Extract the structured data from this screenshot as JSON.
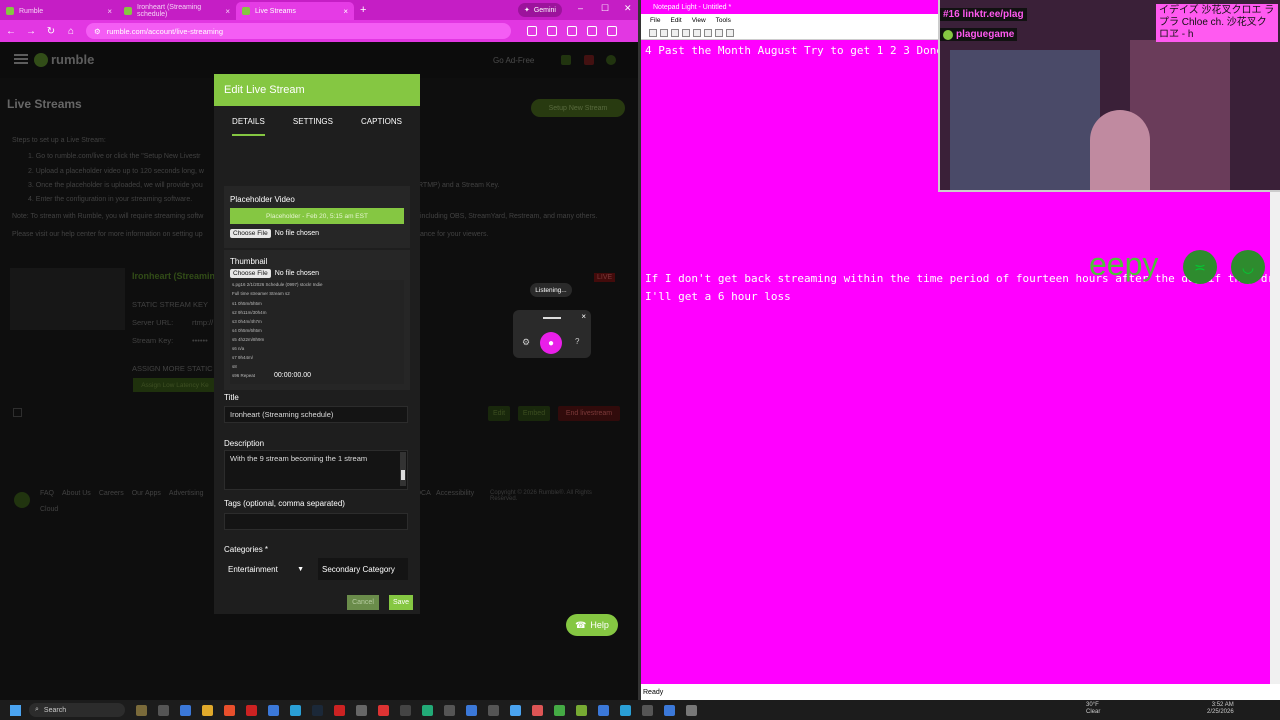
{
  "browser": {
    "tabs": [
      {
        "label": "Rumble",
        "active": false
      },
      {
        "label": "Ironheart (Streaming schedule)",
        "active": false
      },
      {
        "label": "Live Streams",
        "active": true
      }
    ],
    "gemini_label": "Gemini",
    "url": "rumble.com/account/live-streaming"
  },
  "rumble": {
    "logo_text": "rumble",
    "go_ad_free": "Go Ad-Free",
    "page_title": "Live Streams",
    "setup_button": "Setup New Stream",
    "steps_heading": "Steps to set up a Live Stream:",
    "steps": [
      "1. Go to rumble.com/live or click the \"Setup New Livestr",
      "2. Upload a placeholder video up to 120 seconds long, w",
      "3. Once the placeholder is uploaded, we will provide you",
      "4. Enter the configuration in your streaming software."
    ],
    "step3_tail": "RTMP) and a Stream Key.",
    "note": "Note: To stream with Rumble, you will require streaming softw",
    "note_tail": "including OBS, StreamYard, Restream, and many others.",
    "visit": "Please visit our help center for more information on setting up",
    "visit_tail": "ance for your viewers.",
    "stream_name": "Ironheart (Streamin",
    "static_key_label": "STATIC STREAM KEY",
    "server_url_label": "Server URL:",
    "server_url_value": "rtmp://",
    "stream_key_label": "Stream Key:",
    "stream_key_value": "••••••",
    "live_badge": "LIVE",
    "assign_label": "ASSIGN MORE STATIC STR",
    "assign_button": "Assign Low Latency Ke",
    "edit_btn": "Edit",
    "embed_btn": "Embed",
    "end_btn": "End livestream",
    "footer_links": [
      "FAQ",
      "About Us",
      "Careers",
      "Our Apps",
      "Advertising"
    ],
    "footer_cloud": "Cloud",
    "footer_ext": [
      "DCA",
      "Accessibility"
    ],
    "copyright": "Copyright © 2026 Rumble®. All Rights Reserved.",
    "help_button": "Help"
  },
  "modal": {
    "title": "Edit Live Stream",
    "tabs": [
      "DETAILS",
      "SETTINGS",
      "CAPTIONS"
    ],
    "placeholder_label": "Placeholder Video",
    "placeholder_value": "Placeholder - Feb 20, 5:15 am EST",
    "choose_file": "Choose File",
    "no_file": "No file chosen",
    "thumbnail_label": "Thumbnail",
    "thumb_lines": [
      "s.pg16 2/1/2026 Schedule (0997) stock! Indie",
      "Full time streamer Stream s2",
      "s1 0h5m/5h5m",
      "s2 9h11m/30h4m",
      "s3 0h4m/4h7m",
      "s4 0h5m/6h5m",
      "s5 4h22m/8h9m",
      "s6 n/a",
      "s7 9h44m/",
      "s8",
      "s96 Repeat"
    ],
    "thumb_time": "00:00:00.00",
    "title_label": "Title",
    "title_value": "Ironheart (Streaming schedule)",
    "description_label": "Description",
    "description_value": "With the 9 stream becoming the 1 stream",
    "tags_label": "Tags (optional, comma separated)",
    "tags_value": "",
    "categories_label": "Categories *",
    "primary_category": "Entertainment",
    "secondary_category": "Secondary Category",
    "cancel": "Cancel",
    "save": "Save"
  },
  "voice": {
    "listening": "Listening..."
  },
  "notepad": {
    "title": "Notepad Light - Untitled *",
    "menu": [
      "File",
      "Edit",
      "View",
      "Tools"
    ],
    "line1": "4 Past the Month August Try to get 1 2 3 Done",
    "line2": "If I don't get back streaming within the time period of fourteen hours after the day if they dre",
    "line3": "I'll get a 6 hour loss",
    "status": "Ready"
  },
  "overlay": {
    "eepy": "eepy",
    "linktree": "#16 linktr.ee/plag",
    "plague": "plaguegame",
    "jp_tag": "イデイズ 沙花叉クロエ ラプラ Chloe ch. 沙花叉クロヱ - h"
  },
  "taskbar": {
    "search": "Search",
    "weather_temp": "30°F",
    "weather_desc": "Clear",
    "time": "3:52 AM",
    "date": "2/25/2026"
  },
  "colors": {
    "rumble_green": "#85c742",
    "magenta": "#ff00ff",
    "tab_bg": "#c51ec5"
  }
}
